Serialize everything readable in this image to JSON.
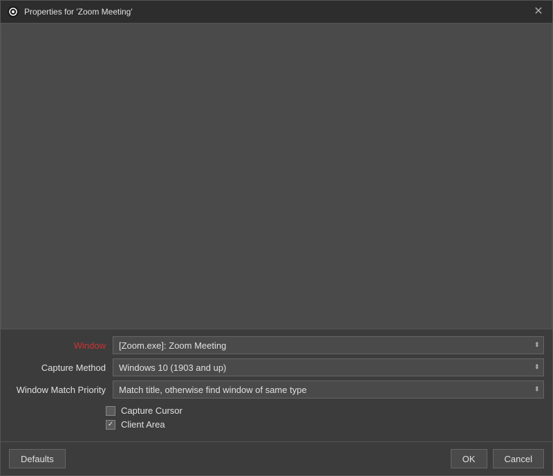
{
  "dialog": {
    "title": "Properties for 'Zoom Meeting'",
    "close_label": "✕"
  },
  "form": {
    "window_label": "Window",
    "window_value": "[Zoom.exe]: Zoom Meeting",
    "capture_method_label": "Capture Method",
    "capture_method_value": "Windows 10 (1903 and up)",
    "window_match_priority_label": "Window Match Priority",
    "window_match_priority_value": "Match title, otherwise find window of same type",
    "capture_cursor_label": "Capture Cursor",
    "client_area_label": "Client Area"
  },
  "footer": {
    "defaults_label": "Defaults",
    "ok_label": "OK",
    "cancel_label": "Cancel"
  },
  "selects": {
    "window_options": [
      "[Zoom.exe]: Zoom Meeting"
    ],
    "capture_method_options": [
      "Windows 10 (1903 and up)"
    ],
    "window_match_priority_options": [
      "Match title, otherwise find window of same type"
    ]
  }
}
